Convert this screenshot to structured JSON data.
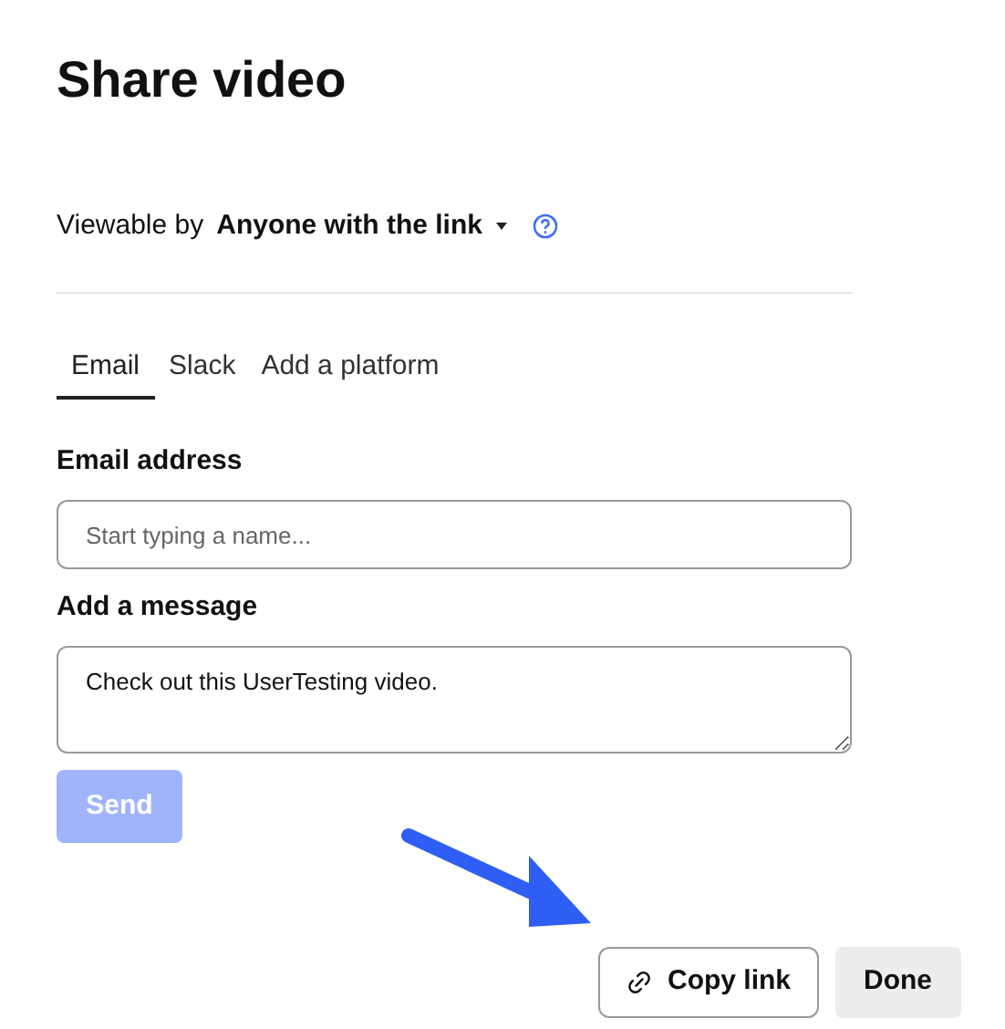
{
  "title": "Share video",
  "viewable": {
    "label": "Viewable by",
    "value": "Anyone with the link"
  },
  "tabs": [
    {
      "label": "Email",
      "selected": true
    },
    {
      "label": "Slack",
      "selected": false
    },
    {
      "label": "Add a platform",
      "selected": false
    }
  ],
  "email_field": {
    "label": "Email address",
    "placeholder": "Start typing a name..."
  },
  "message_field": {
    "label": "Add a message",
    "value": "Check out this UserTesting video."
  },
  "send_button": {
    "label": "Send",
    "disabled": true
  },
  "footer_buttons": [
    {
      "label": "Copy link",
      "kind": "link"
    },
    {
      "label": "Done",
      "kind": "plain"
    }
  ]
}
